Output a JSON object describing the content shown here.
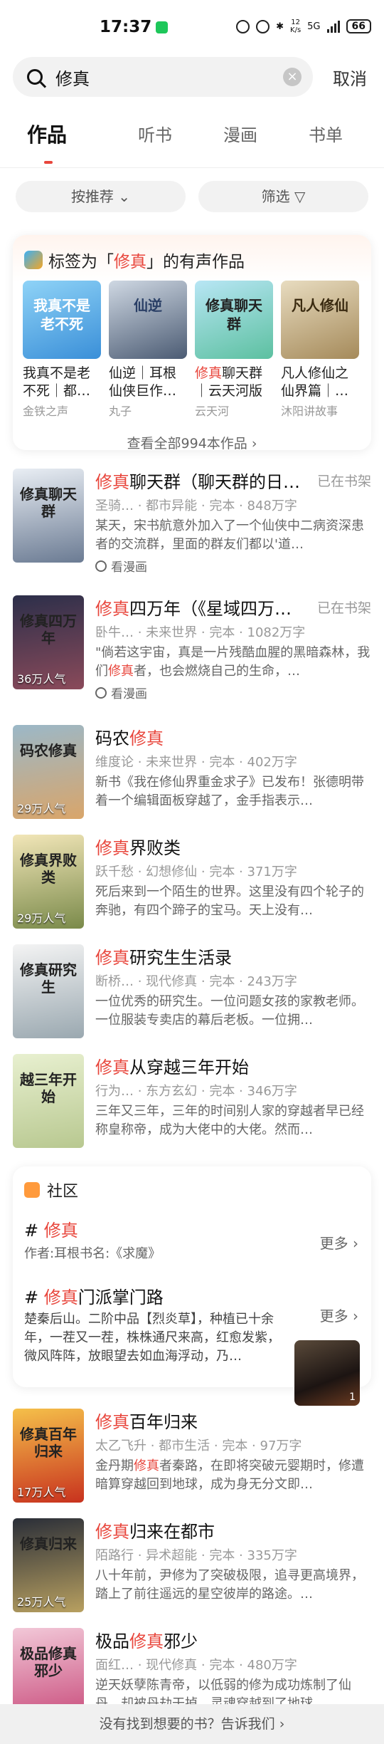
{
  "status": {
    "time": "17:37",
    "net_speed": "12\nK/s",
    "network": "5G",
    "battery": "66"
  },
  "search": {
    "value": "修真",
    "clear": "×",
    "cancel": "取消"
  },
  "tabs": [
    "作品",
    "听书",
    "漫画",
    "书单"
  ],
  "filters": {
    "sort": "按推荐 ⌄",
    "filter": "筛选 ▽"
  },
  "audio": {
    "title_pre": "标签为「",
    "keyword": "修真",
    "title_post": "」的有声作品",
    "items": [
      {
        "title": "我真不是老不死｜都…",
        "author": "金铁之声",
        "cover_text": "我真不是老不死",
        "c1": "#8fd3f7",
        "c2": "#3a8fd8",
        "tc": "#fff"
      },
      {
        "title": "仙逆｜耳根仙侠巨作…",
        "author": "丸子",
        "cover_text": "仙逆",
        "c1": "#cfd8e3",
        "c2": "#4b5b73",
        "tc": "#2a3f66"
      },
      {
        "title_kw": "修真",
        "title": "聊天群｜云天河版",
        "author": "云天河",
        "cover_text": "修真聊天群",
        "c1": "#b8e6f5",
        "c2": "#5cc0a0",
        "tc": "#222"
      },
      {
        "title": "凡人修仙之仙界篇｜…",
        "author": "沐阳讲故事",
        "cover_text": "凡人修仙",
        "c1": "#e8dcc0",
        "c2": "#a58a5a",
        "tc": "#3a2a10"
      }
    ],
    "all": "查看全部994本作品 ›"
  },
  "books1": [
    {
      "kw": "修真",
      "title": "聊天群（聊天群的日…",
      "shelf": "已在书架",
      "meta": "圣骑… · 都市异能 · 完本 · 848万字",
      "desc": "某天，宋书航意外加入了一个仙侠中二病资深患者的交流群，里面的群友们都以'道…",
      "comic": "看漫画",
      "pop": "",
      "cover_text": "修真聊天群",
      "c1": "#e9eef4",
      "c2": "#6b7b93"
    },
    {
      "kw": "修真",
      "title": "四万年（《星域四万…",
      "shelf": "已在书架",
      "meta": "卧牛… · 未来世界 · 完本 · 1082万字",
      "desc_pre": "\"倘若这宇宙，真是一片残酷血腥的黑暗森林，我们",
      "desc_kw": "修真",
      "desc_post": "者，也会燃烧自己的生命，…",
      "comic": "看漫画",
      "pop": "36万人气",
      "cover_text": "修真四万年",
      "c1": "#2c2f4a",
      "c2": "#8a4a5a"
    }
  ],
  "books2": [
    {
      "pre": "码农",
      "kw": "修真",
      "post": "",
      "meta": "维度论 · 未来世界 · 完本 · 402万字",
      "desc": "新书《我在修仙界重金求子》已发布！张德明带着一个编辑面板穿越了，金手指表示…",
      "pop": "29万人气",
      "cover_text": "码农修真",
      "c1": "#9bb8c8",
      "c2": "#d9a56a"
    },
    {
      "pre": "",
      "kw": "修真",
      "post": "界败类",
      "meta": "跃千愁 · 幻想修仙 · 完本 · 371万字",
      "desc": "死后来到一个陌生的世界。这里没有四个轮子的奔驰，有四个蹄子的宝马。天上没有…",
      "pop": "29万人气",
      "cover_text": "修真界败类",
      "c1": "#f2e6b8",
      "c2": "#7a8a4a"
    },
    {
      "pre": "",
      "kw": "修真",
      "post": "研究生生活录",
      "meta": "断桥… · 现代修真 · 完本 · 243万字",
      "desc": "一位优秀的研究生。一位问题女孩的家教老师。一位服装专卖店的幕后老板。一位拥…",
      "pop": "",
      "cover_text": "修真研究生",
      "c1": "#f4f4f4",
      "c2": "#9aa8b0"
    },
    {
      "pre": "",
      "kw": "修真",
      "post": "从穿越三年开始",
      "meta": "行为… · 东方玄幻 · 完本 · 346万字",
      "desc": "三年又三年，三年的时间别人家的穿越者早已经称皇称帝，成为大佬中的大佬。然而…",
      "pop": "",
      "cover_text": "越三年开始",
      "c1": "#e8f0d0",
      "c2": "#b8c890"
    }
  ],
  "community": {
    "title": "社区",
    "topics": [
      {
        "hash": "#",
        "kw": "修真",
        "post": "",
        "more": "更多 ›",
        "author": "作者:耳根书名:《求魔》"
      },
      {
        "hash": "#",
        "kw": "修真",
        "post": "门派掌门路",
        "more": "更多 ›",
        "desc": "楚秦后山。二阶中品【烈炎草】，种植已十余年，一茬又一茬，株株通尺来高，红愈发紫，微风阵阵，放眼望去如血海浮动，乃…",
        "thumb_count": "1"
      }
    ]
  },
  "books3": [
    {
      "pre": "",
      "kw": "修真",
      "post": "百年归来",
      "meta": "太乙飞升 · 都市生活 · 完本 · 97万字",
      "desc_pre": "金丹期",
      "desc_kw": "修真",
      "desc_post": "者秦路，在即将突破元婴期时，修遭暗算穿越回到地球，成为身无分文即…",
      "pop": "17万人气",
      "cover_text": "修真百年归来",
      "c1": "#f5c04a",
      "c2": "#c8321e"
    },
    {
      "pre": "",
      "kw": "修真",
      "post": "归来在都市",
      "meta": "陌路行 · 异术超能 · 完本 · 335万字",
      "desc": "八十年前，尹修为了突破极限，追寻更高境界，踏上了前往遥远的星空彼岸的路途。…",
      "pop": "25万人气",
      "cover_text": "修真归来",
      "c1": "#2a2e38",
      "c2": "#b8a060"
    },
    {
      "pre": "极品",
      "kw": "修真",
      "post": "邪少",
      "meta": "面红… · 现代修真 · 完本 · 480万字",
      "desc": "逆天妖孽陈青帝，以低弱的修为成功炼制了仙丹，却被丹劫干掉，灵魂穿越到了地球…",
      "pop": "",
      "cover_text": "极品修真邪少",
      "c1": "#f2c8d8",
      "c2": "#c84a7a"
    }
  ],
  "bottom": "没有找到想要的书？告诉我们 ›"
}
